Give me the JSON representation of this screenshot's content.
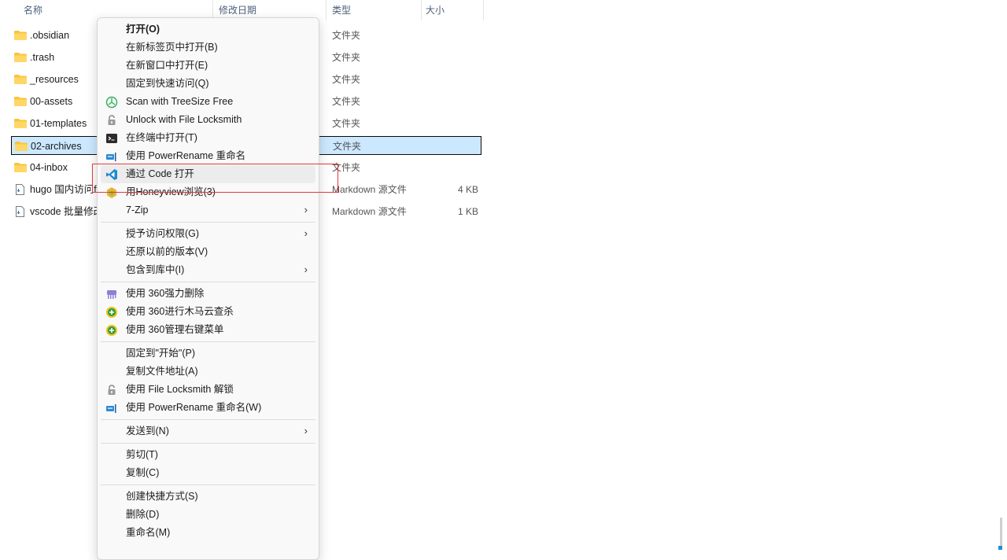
{
  "columns": {
    "name": "名称",
    "modified": "修改日期",
    "type": "类型",
    "size": "大小"
  },
  "files": [
    {
      "name": ".obsidian",
      "type": "文件夹",
      "size": "",
      "kind": "folder",
      "selected": false
    },
    {
      "name": ".trash",
      "type": "文件夹",
      "size": "",
      "kind": "folder",
      "selected": false
    },
    {
      "name": "_resources",
      "type": "文件夹",
      "size": "",
      "kind": "folder",
      "selected": false
    },
    {
      "name": "00-assets",
      "type": "文件夹",
      "size": "",
      "kind": "folder",
      "selected": false
    },
    {
      "name": "01-templates",
      "type": "文件夹",
      "size": "",
      "kind": "folder",
      "selected": false
    },
    {
      "name": "02-archives",
      "type": "文件夹",
      "size": "",
      "kind": "folder",
      "selected": true
    },
    {
      "name": "04-inbox",
      "type": "文件夹",
      "size": "",
      "kind": "folder",
      "selected": false
    },
    {
      "name": "hugo 国内访问f",
      "type": "Markdown 源文件",
      "size": "4 KB",
      "kind": "file",
      "selected": false
    },
    {
      "name": "vscode 批量修改",
      "type": "Markdown 源文件",
      "size": "1 KB",
      "kind": "file",
      "selected": false
    }
  ],
  "context_menu": {
    "items": [
      {
        "label": "打开(O)",
        "icon": "",
        "bold": true,
        "submenu": false
      },
      {
        "label": "在新标签页中打开(B)",
        "icon": "",
        "submenu": false
      },
      {
        "label": "在新窗口中打开(E)",
        "icon": "",
        "submenu": false
      },
      {
        "label": "固定到快速访问(Q)",
        "icon": "",
        "submenu": false
      },
      {
        "label": "Scan with TreeSize Free",
        "icon": "treesize-icon",
        "submenu": false
      },
      {
        "label": "Unlock with File Locksmith",
        "icon": "lock-icon",
        "submenu": false
      },
      {
        "label": "在终端中打开(T)",
        "icon": "terminal-icon",
        "submenu": false
      },
      {
        "label": "使用 PowerRename 重命名",
        "icon": "powerrename-icon",
        "submenu": false
      },
      {
        "label": "通过 Code 打开",
        "icon": "vscode-icon",
        "submenu": false,
        "highlight": true
      },
      {
        "label": "用Honeyview浏览(3)",
        "icon": "honeyview-icon",
        "submenu": false
      },
      {
        "label": "7-Zip",
        "icon": "",
        "submenu": true
      },
      {
        "label": "授予访问权限(G)",
        "icon": "",
        "submenu": true
      },
      {
        "label": "还原以前的版本(V)",
        "icon": "",
        "submenu": false
      },
      {
        "label": "包含到库中(I)",
        "icon": "",
        "submenu": true
      },
      {
        "label": "使用 360强力删除",
        "icon": "shred-360-icon",
        "submenu": false
      },
      {
        "label": "使用 360进行木马云查杀",
        "icon": "antivirus-360-icon",
        "submenu": false
      },
      {
        "label": "使用 360管理右键菜单",
        "icon": "menu-manager-360-icon",
        "submenu": false
      },
      {
        "label": "固定到\"开始\"(P)",
        "icon": "",
        "submenu": false
      },
      {
        "label": "复制文件地址(A)",
        "icon": "",
        "submenu": false
      },
      {
        "label": "使用 File Locksmith 解锁",
        "icon": "lock-icon",
        "submenu": false
      },
      {
        "label": "使用 PowerRename 重命名(W)",
        "icon": "powerrename-icon",
        "submenu": false
      },
      {
        "label": "发送到(N)",
        "icon": "",
        "submenu": true
      },
      {
        "label": "剪切(T)",
        "icon": "",
        "submenu": false
      },
      {
        "label": "复制(C)",
        "icon": "",
        "submenu": false
      },
      {
        "label": "创建快捷方式(S)",
        "icon": "",
        "submenu": false
      },
      {
        "label": "删除(D)",
        "icon": "",
        "submenu": false
      },
      {
        "label": "重命名(M)",
        "icon": "",
        "submenu": false
      }
    ]
  },
  "colors": {
    "selection_bg": "#cce8ff",
    "highlight_box": "#e03a3a",
    "folder": "#f8c43c"
  }
}
